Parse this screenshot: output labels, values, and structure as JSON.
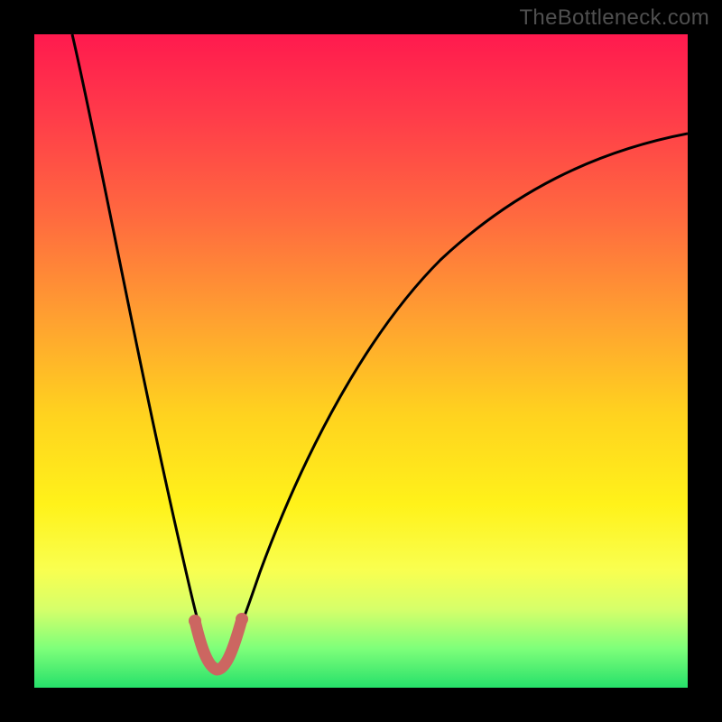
{
  "watermark": "TheBottleneck.com",
  "chart_data": {
    "type": "line",
    "title": "",
    "xlabel": "",
    "ylabel": "",
    "xlim": [
      0,
      100
    ],
    "ylim": [
      0,
      100
    ],
    "series": [
      {
        "name": "curve",
        "x": [
          0,
          3,
          6,
          9,
          12,
          15,
          18,
          20,
          22,
          24,
          25,
          26,
          27,
          30,
          35,
          40,
          45,
          50,
          55,
          60,
          65,
          70,
          75,
          80,
          85,
          90,
          95,
          100
        ],
        "values": [
          100,
          88,
          76,
          64,
          52,
          40,
          28,
          18,
          10,
          4,
          2,
          3,
          5,
          14,
          26,
          36,
          45,
          52,
          58,
          63,
          67,
          71,
          74,
          77,
          79,
          81,
          83,
          85
        ]
      },
      {
        "name": "highlight",
        "x": [
          22,
          23,
          24,
          25,
          26,
          27,
          28
        ],
        "values": [
          9,
          6,
          4,
          2,
          3,
          5,
          8
        ]
      }
    ],
    "highlight_color": "#cc6661",
    "curve_color": "#000000"
  }
}
